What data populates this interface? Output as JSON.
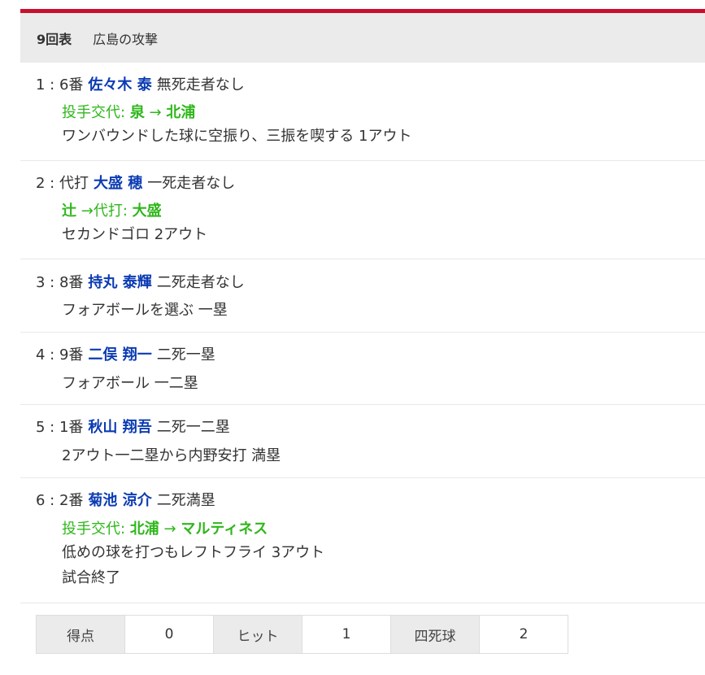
{
  "inning": {
    "label": "9回表",
    "title": "広島の攻撃"
  },
  "plays": [
    {
      "number": "1",
      "order": "6番",
      "batter": "佐々木 泰",
      "situation": "無死走者なし",
      "change": {
        "prefix": "投手交代:",
        "from": "泉",
        "arrow": "→",
        "to": "北浦"
      },
      "results": [
        "ワンバウンドした球に空振り、三振を喫する 1アウト"
      ]
    },
    {
      "number": "2",
      "order": "代打",
      "batter": "大盛 穂",
      "situation": "一死走者なし",
      "change": {
        "from": "辻",
        "arrow": "→代打:",
        "to": "大盛"
      },
      "results": [
        "セカンドゴロ 2アウト"
      ]
    },
    {
      "number": "3",
      "order": "8番",
      "batter": "持丸 泰輝",
      "situation": "二死走者なし",
      "results": [
        "フォアボールを選ぶ 一塁"
      ]
    },
    {
      "number": "4",
      "order": "9番",
      "batter": "二俣 翔一",
      "situation": "二死一塁",
      "results": [
        "フォアボール 一二塁"
      ]
    },
    {
      "number": "5",
      "order": "1番",
      "batter": "秋山 翔吾",
      "situation": "二死一二塁",
      "results": [
        "2アウト一二塁から内野安打 満塁"
      ]
    },
    {
      "number": "6",
      "order": "2番",
      "batter": "菊池 涼介",
      "situation": "二死満塁",
      "change": {
        "prefix": "投手交代:",
        "from": "北浦",
        "arrow": "→",
        "to": "マルティネス"
      },
      "results": [
        "低めの球を打つもレフトフライ 3アウト",
        "試合終了"
      ]
    }
  ],
  "summary": {
    "runs_label": "得点",
    "runs": "0",
    "hits_label": "ヒット",
    "hits": "1",
    "walks_label": "四死球",
    "walks": "2"
  },
  "colors": {
    "accent_red": "#c8102e",
    "batter_blue": "#0b3bb3",
    "change_green": "#2fb71b"
  }
}
